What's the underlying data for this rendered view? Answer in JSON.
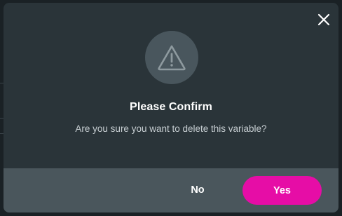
{
  "dialog": {
    "title": "Please Confirm",
    "message": "Are you sure you want to delete this variable?",
    "icon": "warning-triangle-icon",
    "close_icon": "close-icon"
  },
  "footer": {
    "no_label": "No",
    "yes_label": "Yes"
  },
  "colors": {
    "dialog_bg": "#2a3439",
    "footer_bg": "#4a565c",
    "icon_circle_bg": "#49565d",
    "primary_accent": "#e60da6",
    "text_primary": "#ffffff",
    "text_secondary": "#c7ced2"
  }
}
